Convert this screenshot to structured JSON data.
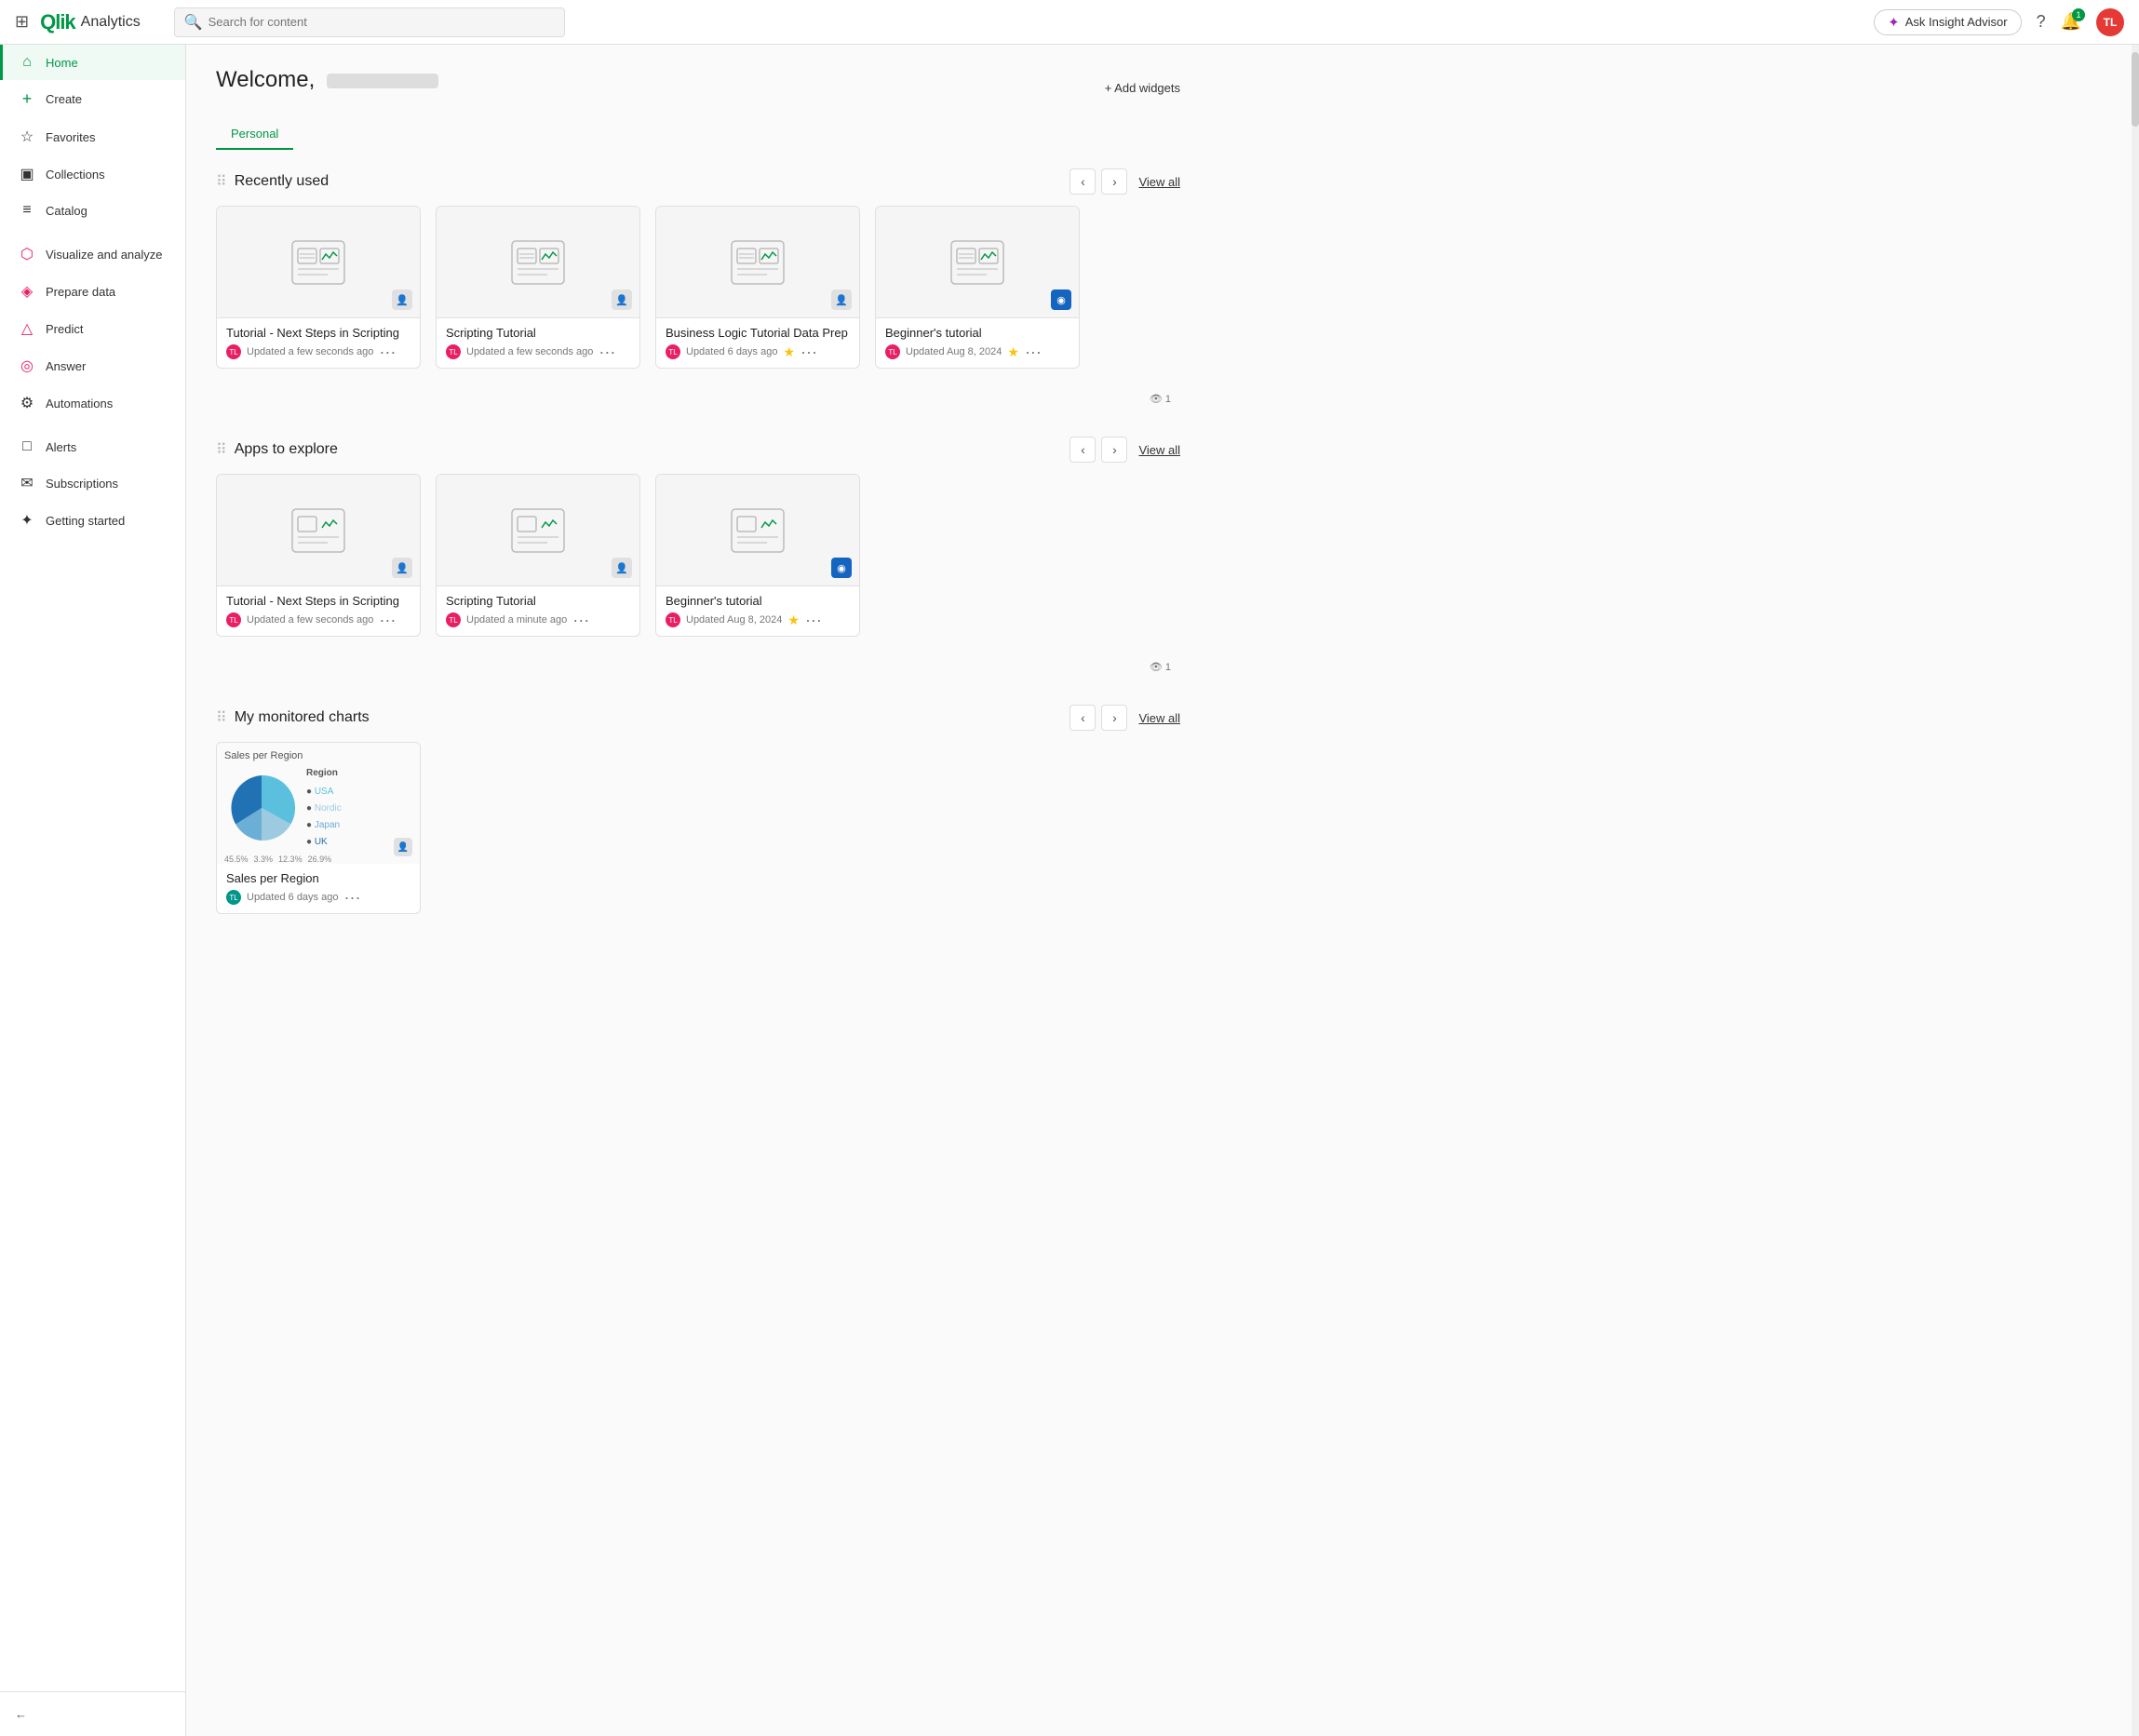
{
  "topnav": {
    "app_name": "Analytics",
    "search_placeholder": "Search for content",
    "ask_insight_label": "Ask Insight Advisor",
    "help_label": "Help",
    "notifications_count": "1",
    "avatar_initials": "TL"
  },
  "sidebar": {
    "items": [
      {
        "id": "home",
        "label": "Home",
        "icon": "⌂",
        "active": true
      },
      {
        "id": "create",
        "label": "Create",
        "icon": "+",
        "active": false
      },
      {
        "id": "favorites",
        "label": "Favorites",
        "icon": "☆",
        "active": false
      },
      {
        "id": "collections",
        "label": "Collections",
        "icon": "▣",
        "active": false
      },
      {
        "id": "catalog",
        "label": "Catalog",
        "icon": "≡",
        "active": false
      },
      {
        "id": "visualize",
        "label": "Visualize and analyze",
        "icon": "⬡",
        "active": false
      },
      {
        "id": "prepare",
        "label": "Prepare data",
        "icon": "◈",
        "active": false
      },
      {
        "id": "predict",
        "label": "Predict",
        "icon": "△",
        "active": false
      },
      {
        "id": "answer",
        "label": "Answer",
        "icon": "◎",
        "active": false
      },
      {
        "id": "automations",
        "label": "Automations",
        "icon": "⚙",
        "active": false
      },
      {
        "id": "alerts",
        "label": "Alerts",
        "icon": "□",
        "active": false
      },
      {
        "id": "subscriptions",
        "label": "Subscriptions",
        "icon": "✉",
        "active": false
      },
      {
        "id": "getting-started",
        "label": "Getting started",
        "icon": "✦",
        "active": false
      }
    ],
    "collapse_label": "Collapse"
  },
  "main": {
    "welcome_prefix": "Welcome,",
    "add_widgets_label": "+ Add widgets",
    "tabs": [
      {
        "id": "personal",
        "label": "Personal",
        "active": true
      }
    ],
    "sections": {
      "recently_used": {
        "title": "Recently used",
        "view_all": "View all",
        "cards": [
          {
            "id": 1,
            "title": "Tutorial - Next Steps in Scripting",
            "updated": "Updated a few seconds ago",
            "avatar": "TL",
            "avatar_color": "pink",
            "starred": false,
            "badge": "person"
          },
          {
            "id": 2,
            "title": "Scripting Tutorial",
            "updated": "Updated a few seconds ago",
            "avatar": "TL",
            "avatar_color": "pink",
            "starred": false,
            "badge": "person"
          },
          {
            "id": 3,
            "title": "Business Logic Tutorial Data Prep",
            "updated": "Updated 6 days ago",
            "avatar": "TL",
            "avatar_color": "pink",
            "starred": true,
            "badge": "person"
          },
          {
            "id": 4,
            "title": "Beginner's tutorial",
            "updated": "Updated Aug 8, 2024",
            "avatar": "TL",
            "avatar_color": "pink",
            "starred": true,
            "badge": "circle-blue"
          }
        ],
        "views_count": "1"
      },
      "apps_to_explore": {
        "title": "Apps to explore",
        "view_all": "View all",
        "cards": [
          {
            "id": 1,
            "title": "Tutorial - Next Steps in Scripting",
            "updated": "Updated a few seconds ago",
            "avatar": "TL",
            "avatar_color": "pink",
            "starred": false,
            "badge": "person"
          },
          {
            "id": 2,
            "title": "Scripting Tutorial",
            "updated": "Updated a minute ago",
            "avatar": "TL",
            "avatar_color": "pink",
            "starred": false,
            "badge": "person"
          },
          {
            "id": 3,
            "title": "Beginner's tutorial",
            "updated": "Updated Aug 8, 2024",
            "avatar": "TL",
            "avatar_color": "pink",
            "starred": true,
            "badge": "circle-blue"
          }
        ],
        "views_count": "1"
      },
      "monitored_charts": {
        "title": "My monitored charts",
        "view_all": "View all",
        "charts": [
          {
            "id": 1,
            "title": "Sales per Region",
            "updated": "Updated 6 days ago",
            "avatar": "TL",
            "avatar_color": "teal",
            "legend": "Region",
            "segments": [
              {
                "label": "USA",
                "value": 45.5,
                "color": "#5bc0de"
              },
              {
                "label": "Nordic",
                "value": 15.9,
                "color": "#9ecae1"
              },
              {
                "label": "Japan",
                "value": 12.3,
                "color": "#6baed6"
              },
              {
                "label": "UK",
                "value": 26.9,
                "color": "#2171b5"
              }
            ],
            "labels": [
              "3.3%",
              "12.3%",
              "45.5%",
              "26.9%"
            ]
          }
        ]
      }
    }
  }
}
